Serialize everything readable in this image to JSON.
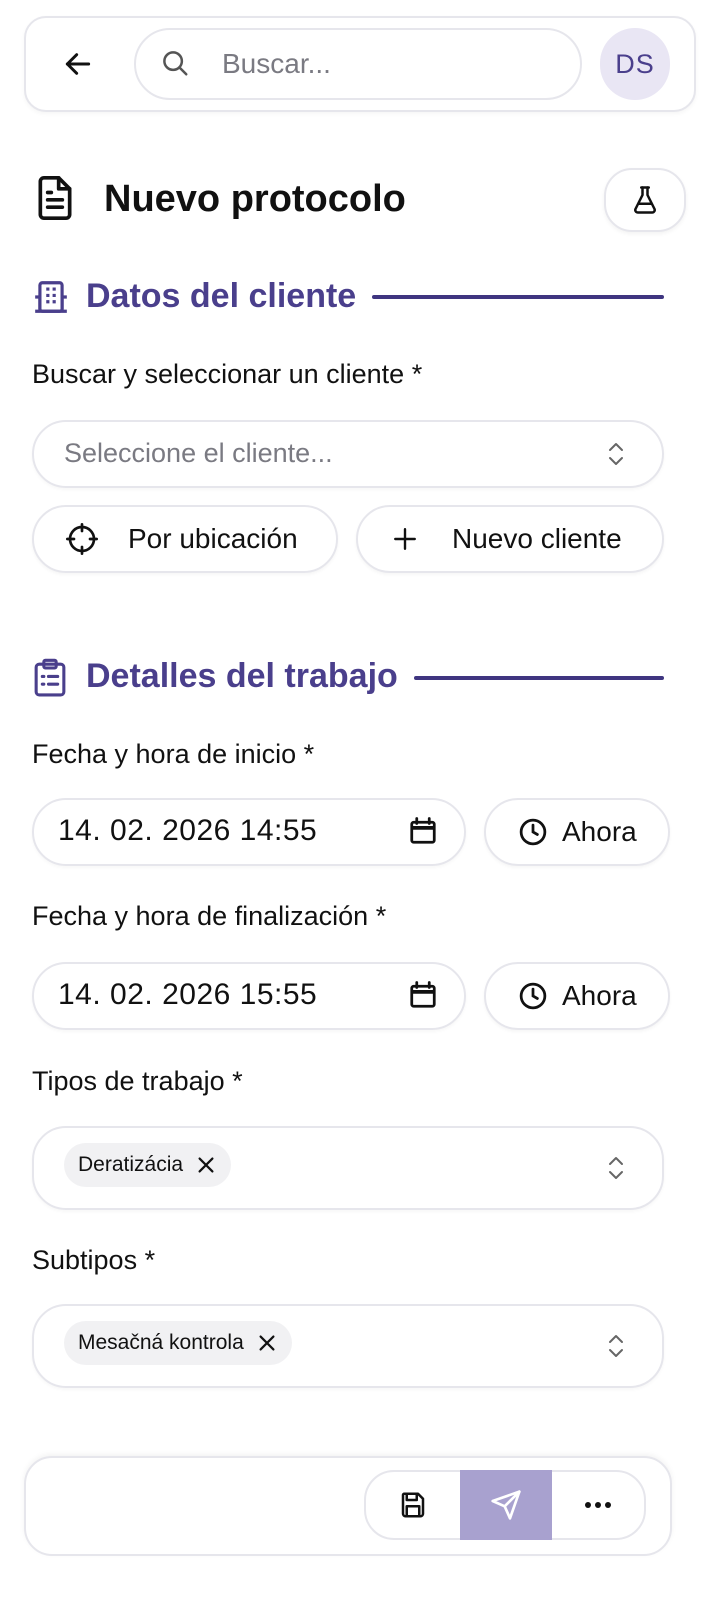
{
  "header": {
    "search_placeholder": "Buscar...",
    "avatar_initials": "DS"
  },
  "page": {
    "title": "Nuevo protocolo"
  },
  "client_section": {
    "title": "Datos del cliente",
    "search_label": "Buscar y seleccionar un cliente *",
    "select_placeholder": "Seleccione el cliente...",
    "by_location_label": "Por ubicación",
    "new_client_label": "Nuevo cliente"
  },
  "work_section": {
    "title": "Detalles del trabajo",
    "start_label": "Fecha y hora de inicio *",
    "start_value": "14. 02. 2026 14:55",
    "end_label": "Fecha y hora de finalización *",
    "end_value": "14. 02. 2026 15:55",
    "now_label": "Ahora",
    "work_types_label": "Tipos de trabajo *",
    "work_types_selected": [
      "Deratizácia"
    ],
    "subtypes_label": "Subtipos *",
    "subtypes_selected": [
      "Mesačná kontrola"
    ]
  },
  "colors": {
    "accent": "#4a3f8c",
    "send_button": "#a8a1cf",
    "border": "#e6e6ec"
  }
}
